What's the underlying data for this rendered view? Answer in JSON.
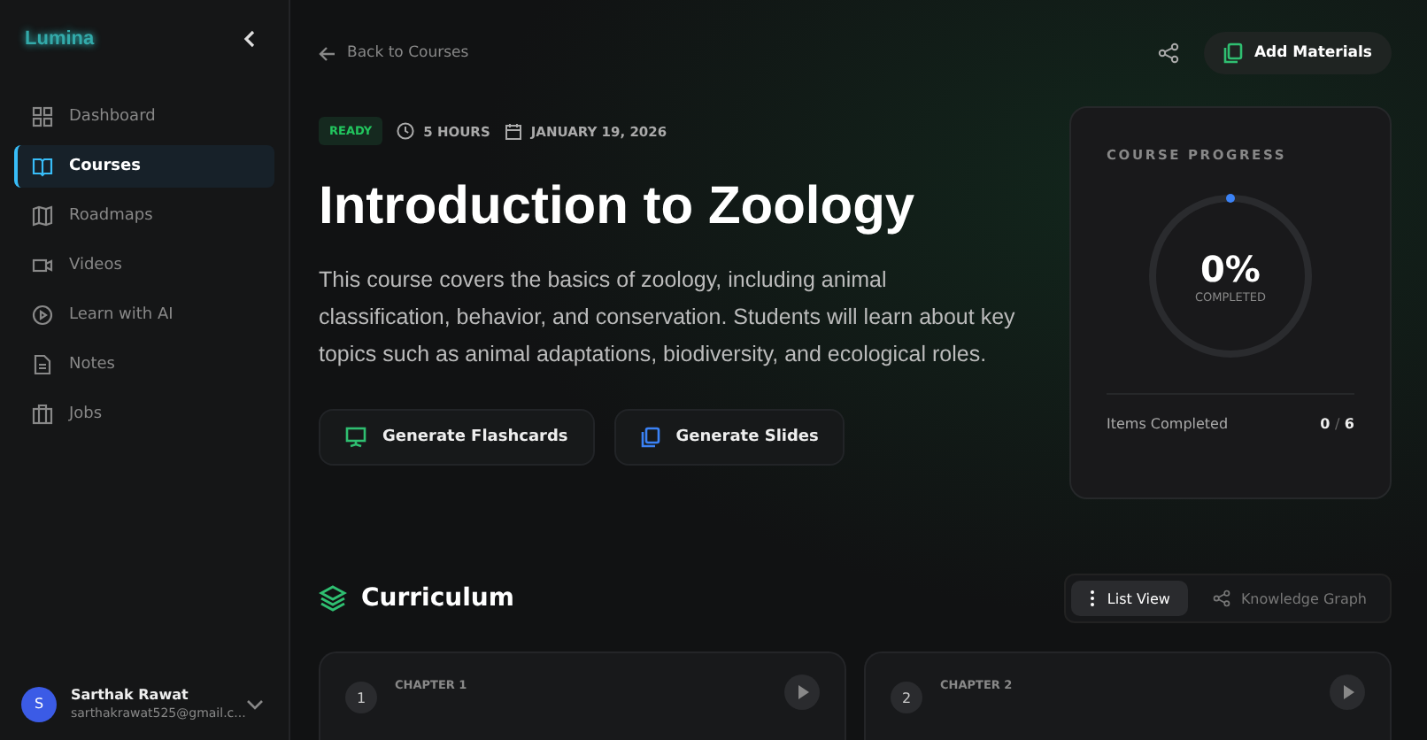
{
  "sidebar": {
    "logo": "Lumina",
    "items": [
      {
        "label": "Dashboard",
        "selected": false
      },
      {
        "label": "Courses",
        "selected": true
      },
      {
        "label": "Roadmaps",
        "selected": false
      },
      {
        "label": "Videos",
        "selected": false
      },
      {
        "label": "Learn with AI",
        "selected": false
      },
      {
        "label": "Notes",
        "selected": false
      },
      {
        "label": "Jobs",
        "selected": false
      }
    ],
    "user": {
      "initial": "S",
      "name": "Sarthak Rawat",
      "email": "sarthakrawat525@gmail.c..."
    }
  },
  "header": {
    "back": "Back to Courses",
    "add_button": "Add Materials"
  },
  "course": {
    "status": "READY",
    "duration": "5 HOURS",
    "date": "JANUARY 19, 2026",
    "title": "Introduction to Zoology",
    "description": "This course covers the basics of zoology, including animal classification, behavior, and conservation. Students will learn about key topics such as animal adaptations, biodiversity, and ecological roles.",
    "actions": [
      {
        "label": "Generate Flashcards"
      },
      {
        "label": "Generate Slides"
      }
    ]
  },
  "progress": {
    "heading": "COURSE PROGRESS",
    "percent": "0%",
    "caption": "COMPLETED",
    "level": 0,
    "items_label": "Items Completed",
    "done": "0",
    "separator": "/",
    "total": "6"
  },
  "curriculum": {
    "heading": "Curriculum",
    "views": [
      {
        "label": "List View",
        "selected": true
      },
      {
        "label": "Knowledge Graph",
        "selected": false
      }
    ],
    "chapters": [
      {
        "label": "CHAPTER 1",
        "number": "1"
      },
      {
        "label": "CHAPTER 2",
        "number": "2"
      }
    ]
  }
}
